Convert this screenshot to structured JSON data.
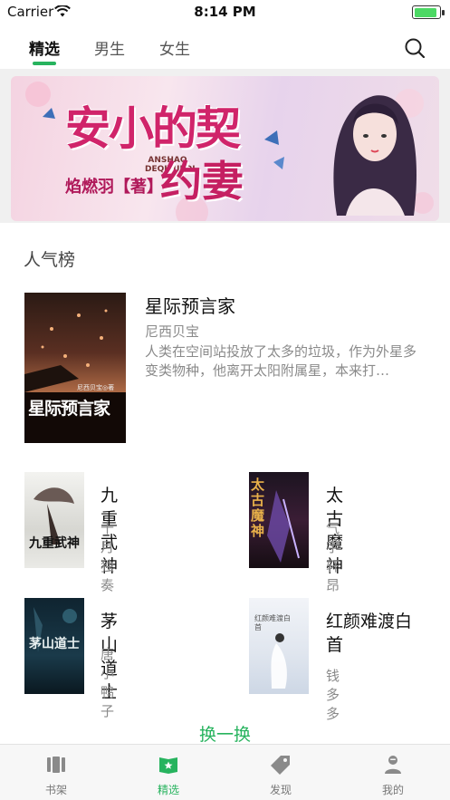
{
  "status_bar": {
    "carrier": "Carrier",
    "time": "8:14 PM",
    "battery_level": 1.0,
    "battery_color": "#4cd964"
  },
  "top_tabs": [
    {
      "label": "精选",
      "active": true
    },
    {
      "label": "男生",
      "active": false
    },
    {
      "label": "女生",
      "active": false
    }
  ],
  "search_icon": "search-icon",
  "accent_color": "#27b35e",
  "banner": {
    "title_line1": "安小的契",
    "title_line2": "约妻",
    "author": "焰燃羽【著】",
    "pinyin": "ANSHAO DEQIYUEQI"
  },
  "section": {
    "title": "人气榜"
  },
  "featured": {
    "title": "星际预言家",
    "author": "尼西贝宝",
    "description": "人类在空间站投放了太多的垃圾，作为外星多变类物种，他离开太阳附属星，本来打…",
    "cover_text": "星际预言家",
    "cover_small": "尼西贝宝◎著"
  },
  "books": [
    {
      "title": "九重武神",
      "author": "十月独奏",
      "cover_text": "九重武神"
    },
    {
      "title": "太古魔神",
      "author": "气宇轩昂",
      "cover_text": "太古魔神"
    },
    {
      "title": "茅山道士",
      "author": "唐小鸭子",
      "cover_text": "茅山道士"
    },
    {
      "title": "红颜难渡白首",
      "author": "钱多多",
      "cover_text": "红颜难渡白首"
    }
  ],
  "refresh_label": "换一换",
  "bottom_nav": [
    {
      "label": "书架",
      "icon": "bookshelf-icon",
      "active": false
    },
    {
      "label": "精选",
      "icon": "featured-star-icon",
      "active": true
    },
    {
      "label": "发现",
      "icon": "tag-icon",
      "active": false
    },
    {
      "label": "我的",
      "icon": "user-icon",
      "active": false
    }
  ]
}
